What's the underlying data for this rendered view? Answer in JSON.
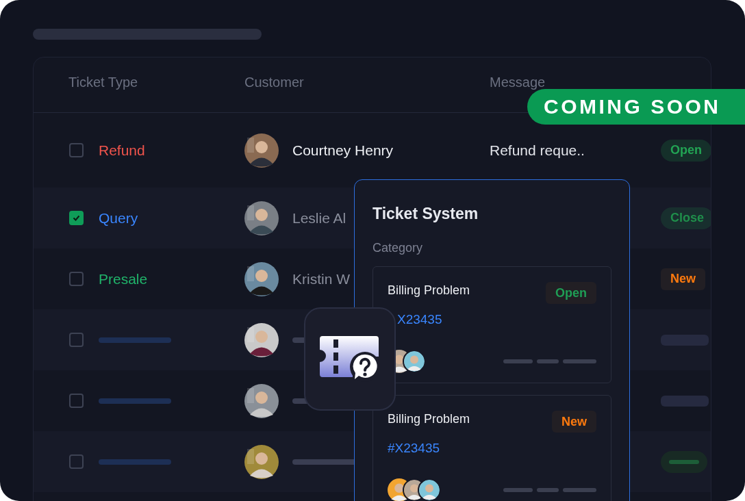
{
  "table": {
    "columns": [
      "Ticket Type",
      "Customer",
      "Message"
    ],
    "rows": [
      {
        "kind": "filled",
        "checked": false,
        "type": "Refund",
        "color": "#f0544c",
        "customer": "Courtney Henry",
        "dimmed": false,
        "message": "Refund reque..",
        "status": {
          "label": "Open",
          "kind": "pill",
          "color": "#22a454"
        }
      },
      {
        "kind": "filled",
        "checked": true,
        "type": "Query",
        "color": "#3a86ff",
        "customer": "Leslie Al",
        "dimmed": true,
        "status": {
          "label": "Close",
          "kind": "pill",
          "color": "#1f8f4b"
        }
      },
      {
        "kind": "filled",
        "checked": false,
        "type": "Presale",
        "color": "#20b36a",
        "customer": "Kristin W",
        "dimmed": true,
        "status": {
          "label": "New",
          "kind": "tag",
          "color": "#ff7a0e"
        }
      },
      {
        "kind": "placeholder",
        "checked": false,
        "status": {
          "kind": "bar",
          "color": "#262a40"
        }
      },
      {
        "kind": "placeholder",
        "checked": false,
        "status": {
          "kind": "bar",
          "color": "#262a40"
        }
      },
      {
        "kind": "placeholder",
        "checked": false,
        "status": {
          "kind": "greenbar",
          "color": "#1d5e38"
        }
      }
    ]
  },
  "ribbon": {
    "label": "COMING SOON"
  },
  "panel": {
    "title": "Ticket System",
    "label": "Category",
    "tickets": [
      {
        "title": "Billing Problem",
        "id": "X23435",
        "status": {
          "label": "Open",
          "kind": "tag",
          "color": "#1f9d55"
        }
      },
      {
        "title": "Billing Problem",
        "id": "#X23435",
        "status": {
          "label": "New",
          "kind": "tag",
          "color": "#ff7a0e"
        }
      }
    ]
  }
}
